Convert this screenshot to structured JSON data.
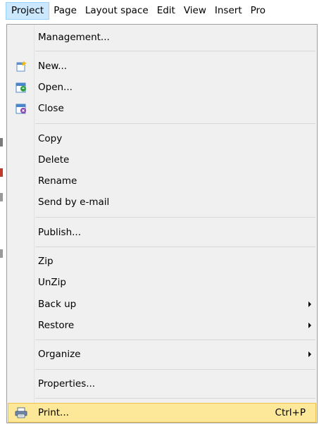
{
  "menubar": {
    "items": [
      "Project",
      "Page",
      "Layout space",
      "Edit",
      "View",
      "Insert",
      "Pro"
    ]
  },
  "menu": {
    "management": "Management...",
    "new": "New...",
    "open": "Open...",
    "close": "Close",
    "copy": "Copy",
    "delete": "Delete",
    "rename": "Rename",
    "send_by_email": "Send by e-mail",
    "publish": "Publish...",
    "zip": "Zip",
    "unzip": "UnZip",
    "back_up": "Back up",
    "restore": "Restore",
    "organize": "Organize",
    "properties": "Properties...",
    "print": "Print...",
    "print_shortcut": "Ctrl+P"
  },
  "colors": {
    "highlight_bg": "#fde89a",
    "highlight_border": "#f2c14a",
    "menubar_active_bg": "#cce8ff",
    "menu_bg": "#f0f0f0"
  },
  "icons": {
    "new": "new-document-icon",
    "open": "open-project-icon",
    "close": "close-project-icon",
    "print": "printer-icon",
    "submenu": "submenu-arrow-icon"
  }
}
